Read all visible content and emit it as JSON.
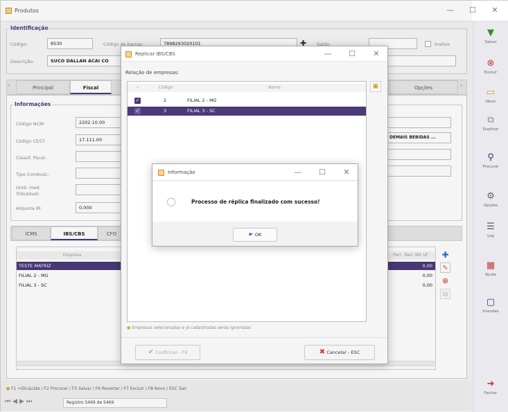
{
  "window": {
    "title": "Produtos",
    "controls": [
      "—",
      "☐",
      "✕"
    ]
  },
  "identificacao": {
    "group_label": "Identificação",
    "codigo_label": "Código:",
    "codigo_value": "8530",
    "codigo_barras_label": "Código de barras:",
    "codigo_barras_value": "7898293020101",
    "saldo_label": "Saldo:",
    "saldo_value": "",
    "inativo_label": "Inativo",
    "descricao_label": "Descrição:",
    "descricao_value": "SUCO DALLAN ACAI CO"
  },
  "main_tabs": {
    "principal": "Principal",
    "fiscal": "Fiscal",
    "opcoes": "Opções"
  },
  "informacoes": {
    "group_label": "Informações",
    "ncm_label": "Código NCM:",
    "ncm_value": "2202.10.00",
    "cest_label": "Código CEST:",
    "cest_value": "17.111.00",
    "classif_label": "Classif. fiscal:",
    "combust_label": "Tipo Combust.:",
    "unid_label": "Unid. med. Tributável:",
    "aliquota_label": "Alíquota IR:",
    "aliquota_value": "0,000",
    "demais_bebidas": "DEMAIS BEBIDAS ..."
  },
  "sub_tabs": {
    "icms": "ICMS",
    "ibs": "IBS/CBS",
    "cfo": "CFO"
  },
  "empresas_table": {
    "header_empresa": "Empresa",
    "header_red": "Perc. Red. IBS UF",
    "rows": [
      {
        "name": "TESTE MATRIZ",
        "value": "0,00"
      },
      {
        "name": "FILIAL 2 - MG",
        "value": "0,00"
      },
      {
        "name": "FILIAL 3 - SC",
        "value": "0,00"
      }
    ]
  },
  "sidebar": {
    "salvar": "Salvar",
    "excluir": "Excluir",
    "novo": "Novo",
    "duplicar": "Duplicar",
    "procurar": "Procurar",
    "opcoes": "Opções",
    "log": "Log",
    "ajuda": "Ajuda",
    "imendes": "Imendes",
    "fechar": "Fechar"
  },
  "replicar_dialog": {
    "title": "Replicar IBS/CBS",
    "relacao_label": "Relação de empresas:",
    "col_check": "✓",
    "col_codigo": "Código",
    "col_nome": "Nome",
    "rows": [
      {
        "codigo": "2",
        "nome": "FILIAL 2 - MG"
      },
      {
        "codigo": "3",
        "nome": "FILIAL 3 - SC"
      }
    ],
    "hint": "Empresas selecionadas e já cadastradas serão ignoradas",
    "confirmar": "Confirmar - F9",
    "cancelar": "Cancelar - ESC"
  },
  "info_dialog": {
    "title": "Informação",
    "message": "Processo de réplica finalizado com sucesso!",
    "ok": "OK"
  },
  "status_bar": {
    "shortcuts": "F1 =DicaListe / F2 Procurar / F5 Salvar / F6 Reverter / F7 Excluir / F8 Novo / ESC Sair",
    "registro": "Registro 5469 de 5469"
  },
  "colors": {
    "accent": "#4a3a78",
    "danger": "#d9342b"
  }
}
